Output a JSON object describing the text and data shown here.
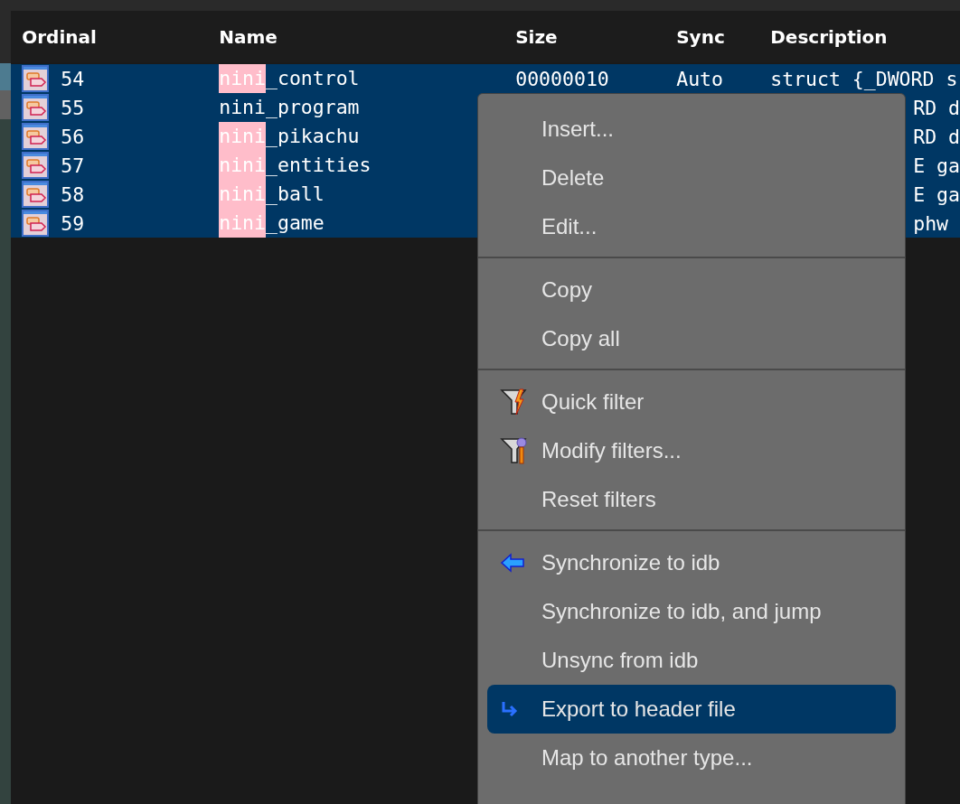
{
  "table": {
    "columns": [
      "Ordinal",
      "Name",
      "Size",
      "Sync",
      "Description"
    ],
    "rows": [
      {
        "ordinal": "54",
        "match": "nini",
        "rest": "_control",
        "highlighted": true,
        "size": "00000010",
        "sync": "Auto",
        "description": "struct {_DWORD s"
      },
      {
        "ordinal": "55",
        "match": "nini",
        "rest": "_program",
        "highlighted": false,
        "description": "RD d"
      },
      {
        "ordinal": "56",
        "match": "nini",
        "rest": "_pikachu",
        "highlighted": true,
        "description": "RD d"
      },
      {
        "ordinal": "57",
        "match": "nini",
        "rest": "_entities",
        "highlighted": true,
        "description": "E ga"
      },
      {
        "ordinal": "58",
        "match": "nini",
        "rest": "_ball",
        "highlighted": true,
        "description": "E ga"
      },
      {
        "ordinal": "59",
        "match": "nini",
        "rest": "_game",
        "highlighted": true,
        "description": "phw"
      }
    ]
  },
  "menu": {
    "groups": [
      [
        {
          "label": "Insert...",
          "selected": false
        },
        {
          "label": "Delete",
          "selected": false
        },
        {
          "label": "Edit...",
          "selected": false
        }
      ],
      [
        {
          "label": "Copy",
          "selected": false
        },
        {
          "label": "Copy all",
          "selected": false
        }
      ],
      [
        {
          "label": "Quick filter",
          "selected": false
        },
        {
          "label": "Modify filters...",
          "selected": false
        },
        {
          "label": "Reset filters",
          "selected": false
        }
      ],
      [
        {
          "label": "Synchronize to idb",
          "selected": false
        },
        {
          "label": "Synchronize to idb, and jump",
          "selected": false
        },
        {
          "label": "Unsync from idb",
          "selected": false
        },
        {
          "label": "Export to header file",
          "selected": true
        },
        {
          "label": "Map to another type...",
          "selected": false
        }
      ]
    ]
  }
}
